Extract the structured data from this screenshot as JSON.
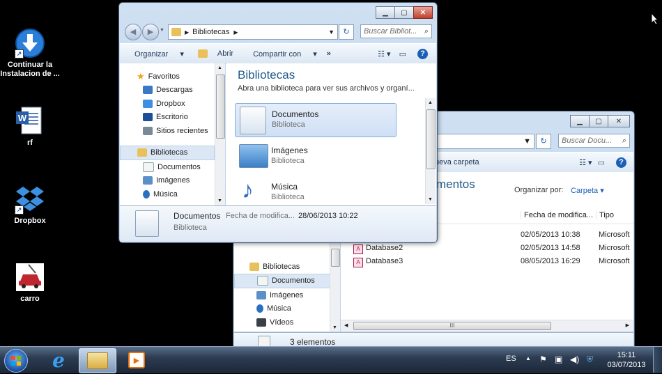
{
  "desktop": {
    "icons": [
      {
        "label": "Continuar la Instalacion de ...",
        "icon": "download-arrow-icon"
      },
      {
        "label": "rf",
        "icon": "word-document-icon"
      },
      {
        "label": "Dropbox",
        "icon": "dropbox-icon"
      },
      {
        "label": "carro",
        "icon": "car-icon"
      }
    ]
  },
  "front_window": {
    "address": {
      "crumb": "Bibliotecas"
    },
    "search_placeholder": "Buscar Bibliot...",
    "toolbar": {
      "organize": "Organizar",
      "open": "Abrir",
      "share": "Compartir con",
      "more": "»"
    },
    "nav": {
      "favorites": "Favoritos",
      "items_fav": [
        "Descargas",
        "Dropbox",
        "Escritorio",
        "Sitios recientes"
      ],
      "libraries": "Bibliotecas",
      "items_lib": [
        "Documentos",
        "Imágenes",
        "Música"
      ]
    },
    "content": {
      "title": "Bibliotecas",
      "subtitle": "Abra una biblioteca para ver sus archivos y organí...",
      "libraries": [
        {
          "name": "Documentos",
          "type": "Biblioteca"
        },
        {
          "name": "Imágenes",
          "type": "Biblioteca"
        },
        {
          "name": "Música",
          "type": "Biblioteca"
        }
      ]
    },
    "details": {
      "name": "Documentos",
      "date_label": "Fecha de modifica...",
      "date_value": "28/06/2013 10:22",
      "type": "Biblioteca"
    }
  },
  "back_window": {
    "search_placeholder": "Buscar Docu...",
    "toolbar": {
      "new_folder": "ueva carpeta"
    },
    "content_title": "mentos",
    "arrange_label": "Organizar por:",
    "arrange_value": "Carpeta",
    "columns": {
      "date": "Fecha de modifica...",
      "type": "Tipo"
    },
    "rows": [
      {
        "name": "",
        "date": "02/05/2013 10:38",
        "type": "Microsoft"
      },
      {
        "name": "Database2",
        "date": "02/05/2013 14:58",
        "type": "Microsoft"
      },
      {
        "name": "Database3",
        "date": "08/05/2013 16:29",
        "type": "Microsoft"
      }
    ],
    "nav": {
      "libraries": "Bibliotecas",
      "items": [
        "Documentos",
        "Imágenes",
        "Música",
        "Vídeos"
      ]
    },
    "hscroll_grip": "III",
    "status": "3 elementos"
  },
  "taskbar": {
    "lang": "ES",
    "time": "15:11",
    "date": "03/07/2013"
  }
}
